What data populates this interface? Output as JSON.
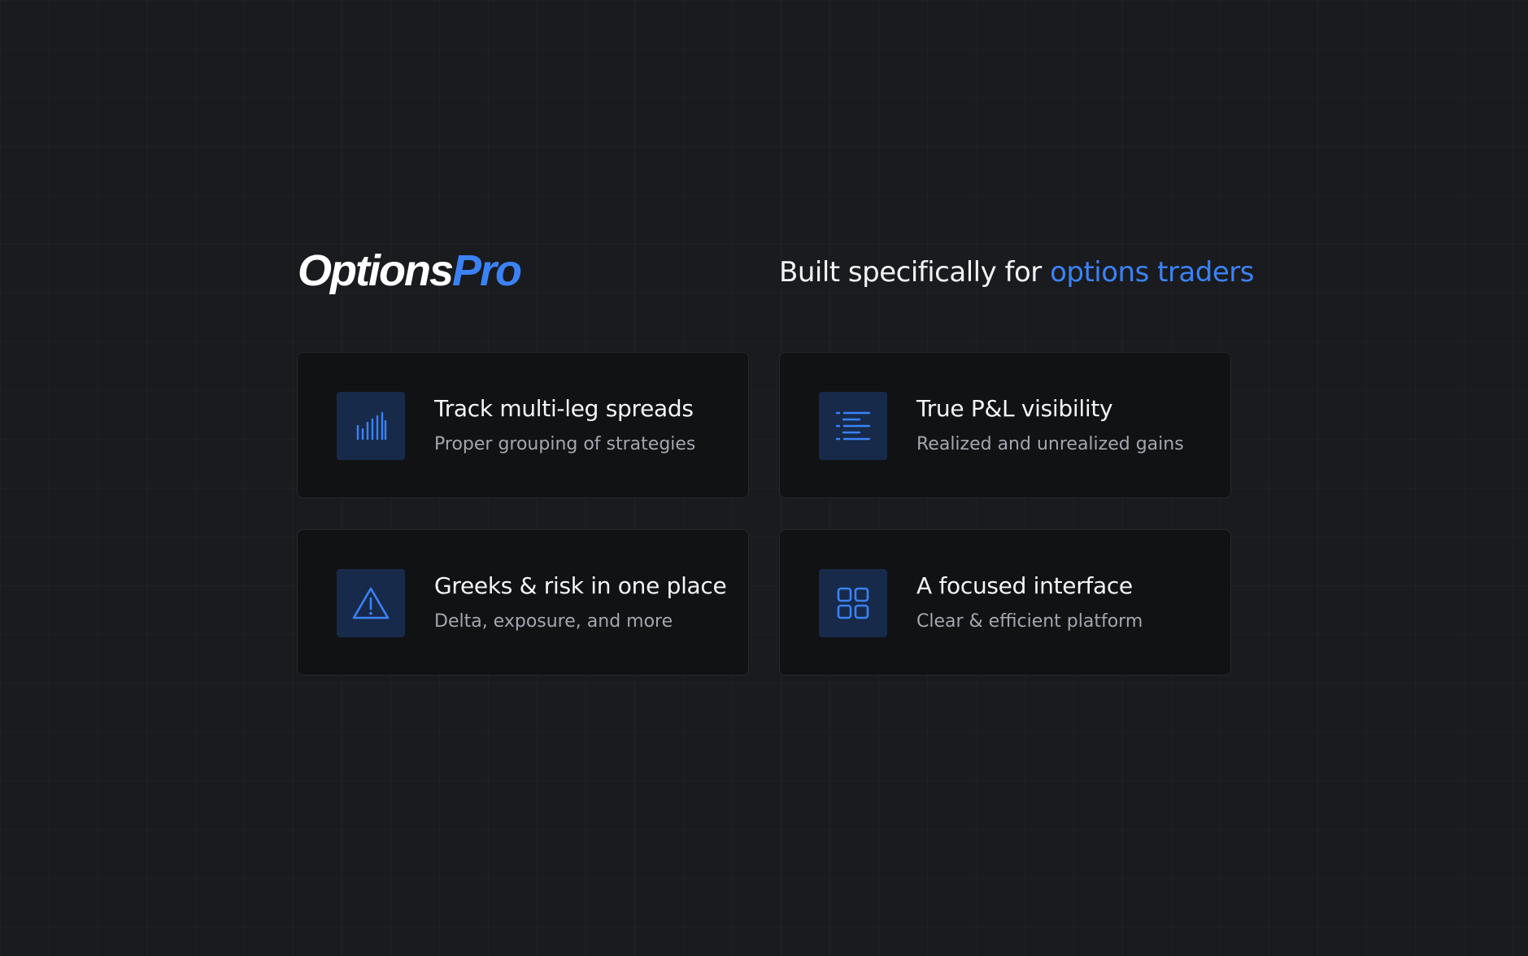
{
  "brand": {
    "logo_part_a": "Options",
    "logo_part_b": "Pro"
  },
  "tagline": {
    "prefix": "Built specifically for ",
    "accent": "options traders"
  },
  "features": [
    {
      "icon": "bar-chart-icon",
      "title": "Track multi-leg spreads",
      "subtitle": "Proper grouping of strategies"
    },
    {
      "icon": "list-icon",
      "title": "True P&L visibility",
      "subtitle": "Realized and unrealized gains"
    },
    {
      "icon": "warning-triangle-icon",
      "title": "Greeks & risk in one place",
      "subtitle": "Delta, exposure, and more"
    },
    {
      "icon": "grid-icon",
      "title": "A focused interface",
      "subtitle": "Clear & efficient platform"
    }
  ],
  "colors": {
    "background": "#1a1b1e",
    "card_background": "#111214",
    "accent": "#3b82f6",
    "icon_box": "#172a4a",
    "text_primary": "#f2f3f5",
    "text_secondary": "#a3a7ae"
  }
}
